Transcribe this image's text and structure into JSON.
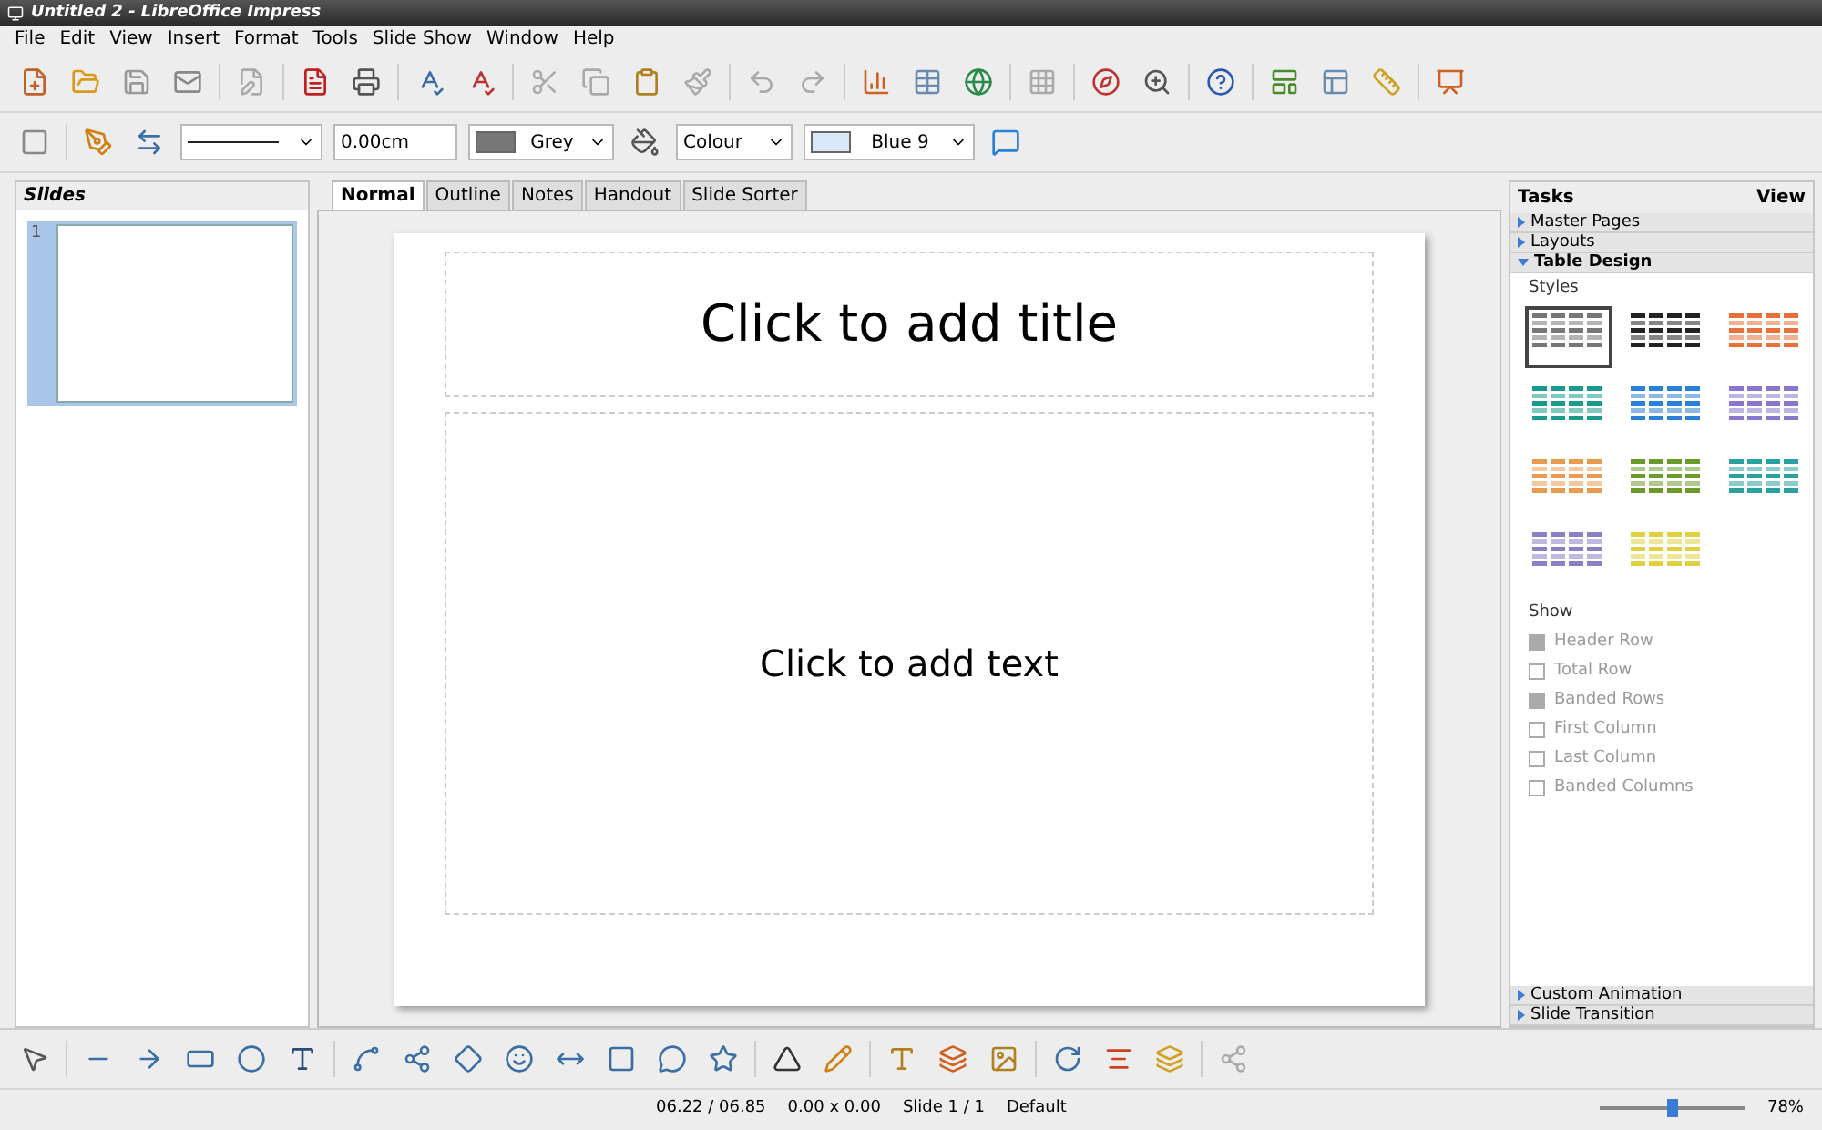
{
  "window": {
    "title": "Untitled 2 - LibreOffice Impress"
  },
  "menu": [
    "File",
    "Edit",
    "View",
    "Insert",
    "Format",
    "Tools",
    "Slide Show",
    "Window",
    "Help"
  ],
  "line_toolbar": {
    "line_width": "0.00cm",
    "line_color": "Grey",
    "area_style": "Colour",
    "fill": "Blue 9"
  },
  "slides_pane": {
    "title": "Slides",
    "slides": [
      {
        "number": "1",
        "selected": true
      }
    ]
  },
  "tabs": [
    {
      "label": "Normal",
      "selected": true
    },
    {
      "label": "Outline",
      "selected": false
    },
    {
      "label": "Notes",
      "selected": false
    },
    {
      "label": "Handout",
      "selected": false
    },
    {
      "label": "Slide Sorter",
      "selected": false
    }
  ],
  "slide": {
    "title_placeholder": "Click to add title",
    "text_placeholder": "Click to add text"
  },
  "tasks": {
    "title": "Tasks",
    "view": "View",
    "sections": [
      {
        "label": "Master Pages",
        "expanded": false
      },
      {
        "label": "Layouts",
        "expanded": false
      },
      {
        "label": "Table Design",
        "expanded": true
      }
    ],
    "styles_label": "Styles",
    "styles": [
      {
        "color": "#777777",
        "selected": true
      },
      {
        "color": "#222222",
        "selected": false
      },
      {
        "color": "#e8703a",
        "selected": false
      },
      {
        "color": "#1a9a8a",
        "selected": false
      },
      {
        "color": "#2a7fd6",
        "selected": false
      },
      {
        "color": "#8877cc",
        "selected": false
      },
      {
        "color": "#e89a50",
        "selected": false
      },
      {
        "color": "#6a9a2a",
        "selected": false
      },
      {
        "color": "#2aa0a0",
        "selected": false
      },
      {
        "color": "#8a80c8",
        "selected": false
      },
      {
        "color": "#e0d040",
        "selected": false
      }
    ],
    "show_label": "Show",
    "options": [
      {
        "label": "Header Row",
        "checked": true,
        "disabled": true
      },
      {
        "label": "Total Row",
        "checked": false,
        "disabled": true
      },
      {
        "label": "Banded Rows",
        "checked": true,
        "disabled": true
      },
      {
        "label": "First Column",
        "checked": false,
        "disabled": true
      },
      {
        "label": "Last Column",
        "checked": false,
        "disabled": true
      },
      {
        "label": "Banded Columns",
        "checked": false,
        "disabled": true
      }
    ],
    "bottom_sections": [
      {
        "label": "Custom Animation",
        "expanded": false
      },
      {
        "label": "Slide Transition",
        "expanded": false
      }
    ]
  },
  "status_bar": {
    "position": "06.22 / 06.85",
    "size": "0.00 x 0.00",
    "slide": "Slide 1 / 1",
    "master": "Default",
    "zoom": {
      "level": 0.5
    },
    "zoom_text": "78%"
  }
}
